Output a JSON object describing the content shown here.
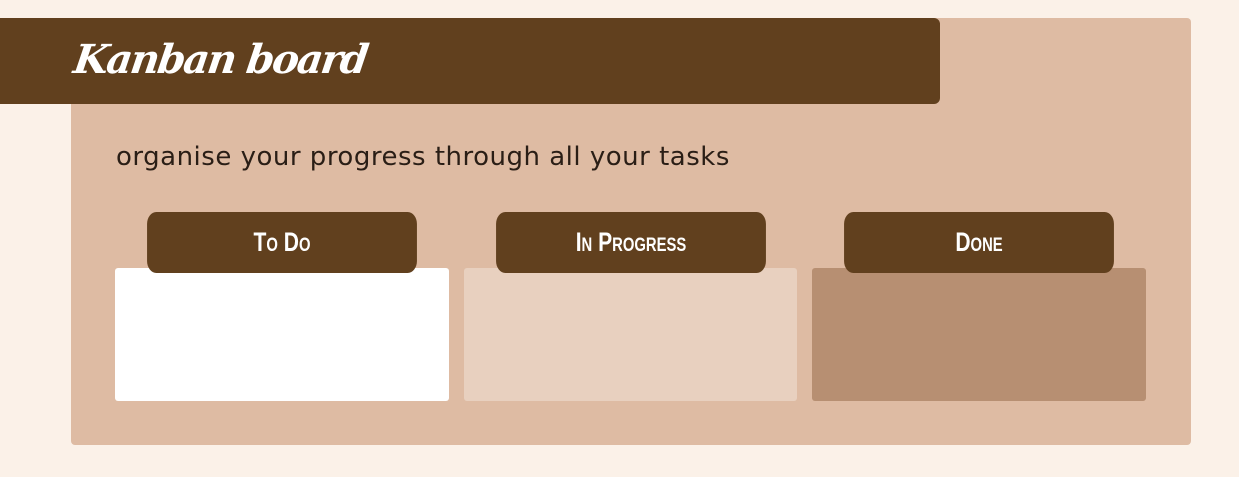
{
  "header": {
    "title": "Kanban board",
    "subtitle": "organise your progress through all your tasks"
  },
  "columns": [
    {
      "label": "To Do",
      "color": "#ffffff"
    },
    {
      "label": "In Progress",
      "color": "#e8d0bf"
    },
    {
      "label": "Done",
      "color": "#b78f72"
    }
  ],
  "colors": {
    "page_background": "#fbf1e8",
    "board_background": "#debba3",
    "accent_brown": "#61401e"
  }
}
